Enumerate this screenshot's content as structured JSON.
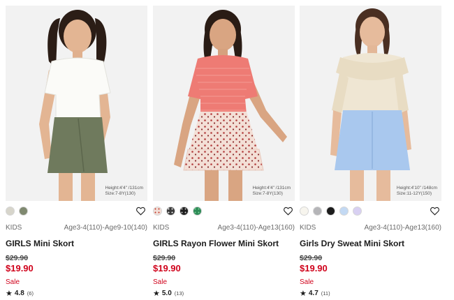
{
  "products": [
    {
      "size_note_line1": "Height:4'4\" /131cm",
      "size_note_line2": "Size:7-8Y(130)",
      "colors": [
        "#d7d5cb",
        "#7f8970"
      ],
      "category": "KIDS",
      "ages": "Age3-4(110)-Age9-10(140)",
      "title": "GIRLS Mini Skort",
      "original_price": "$29.90",
      "sale_price": "$19.90",
      "sale_label": "Sale",
      "rating": "4.8",
      "review_count": "(6)"
    },
    {
      "size_note_line1": "Height:4'4\" /131cm",
      "size_note_line2": "Size:7-8Y(130)",
      "colors": [
        "#f2ddd6",
        "#3a3a3a",
        "#1f1f1f",
        "#2e8b57"
      ],
      "category": "KIDS",
      "ages": "Age3-4(110)-Age13(160)",
      "title": "GIRLS Rayon Flower Mini Skort",
      "original_price": "$29.90",
      "sale_price": "$19.90",
      "sale_label": "Sale",
      "rating": "5.0",
      "review_count": "(13)"
    },
    {
      "size_note_line1": "Height:4'10\" /148cm",
      "size_note_line2": "Size:11-12Y(150)",
      "colors": [
        "#f7f5ee",
        "#b5b5b8",
        "#1c1c1c",
        "#c3d9f3",
        "#d8d0f2"
      ],
      "category": "KIDS",
      "ages": "Age3-4(110)-Age13(160)",
      "title": "Girls Dry Sweat Mini Skort",
      "original_price": "$29.90",
      "sale_price": "$19.90",
      "sale_label": "Sale",
      "rating": "4.7",
      "review_count": "(11)"
    }
  ]
}
